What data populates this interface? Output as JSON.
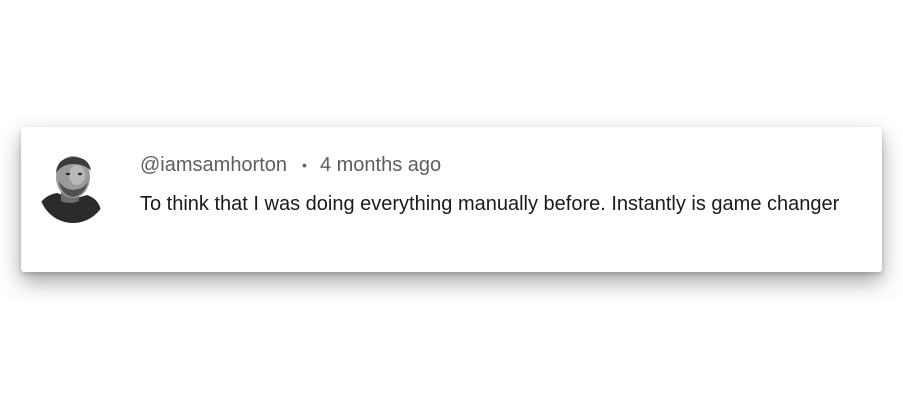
{
  "comment": {
    "author_handle": "@iamsamhorton",
    "separator": "•",
    "timestamp": "4 months ago",
    "text": "To think that I was doing everything manually before. Instantly is game changer"
  },
  "avatar": {
    "icon": "user-avatar-photo"
  }
}
